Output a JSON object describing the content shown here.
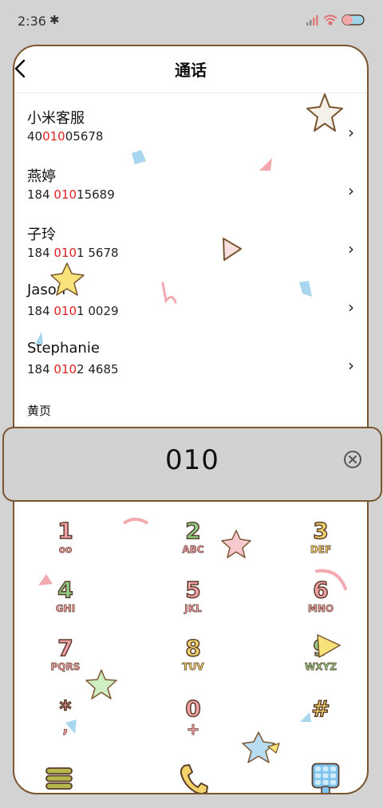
{
  "status": {
    "time": "2:36",
    "bluetooth_icon": "bluetooth-icon",
    "signal_icon": "signal-icon",
    "wifi_icon": "wifi-icon",
    "battery_icon": "battery-icon"
  },
  "header": {
    "title": "通话",
    "back_icon": "back-arrow-icon"
  },
  "contacts": [
    {
      "name": "小米客服",
      "num_pre": "40",
      "num_hl": "010",
      "num_post": "05678"
    },
    {
      "name": "燕婷",
      "num_pre": "184 ",
      "num_hl": "010",
      "num_post": "15689"
    },
    {
      "name": "子玲",
      "num_pre": "184 ",
      "num_hl": "010",
      "num_post": "1 5678"
    },
    {
      "name": "Jason",
      "num_pre": "184 ",
      "num_hl": "010",
      "num_post": "1 0029"
    },
    {
      "name": "Stephanie",
      "num_pre": "184 ",
      "num_hl": "010",
      "num_post": "2 4685"
    }
  ],
  "section_yellow_pages": "黄页",
  "dialer": {
    "input": "010",
    "delete_icon": "backspace-icon"
  },
  "keypad": [
    {
      "digit": "1",
      "letters": "oo"
    },
    {
      "digit": "2",
      "letters": "ABC"
    },
    {
      "digit": "3",
      "letters": "DEF"
    },
    {
      "digit": "4",
      "letters": "GHI"
    },
    {
      "digit": "5",
      "letters": "JKL"
    },
    {
      "digit": "6",
      "letters": "MNO"
    },
    {
      "digit": "7",
      "letters": "PQRS"
    },
    {
      "digit": "8",
      "letters": "TUV"
    },
    {
      "digit": "9",
      "letters": "WXYZ"
    },
    {
      "digit": "*",
      "letters": ","
    },
    {
      "digit": "0",
      "letters": "+"
    },
    {
      "digit": "#",
      "letters": ""
    }
  ],
  "bottom_bar": {
    "menu_icon": "menu-icon",
    "call_icon": "phone-call-icon",
    "keypad_icon": "keypad-icon"
  },
  "colors": {
    "border": "#7a5630",
    "highlight": "#e02020",
    "key_pink": "#f3a0a8",
    "key_green": "#8fcf87",
    "key_yellow": "#f3d46b"
  }
}
